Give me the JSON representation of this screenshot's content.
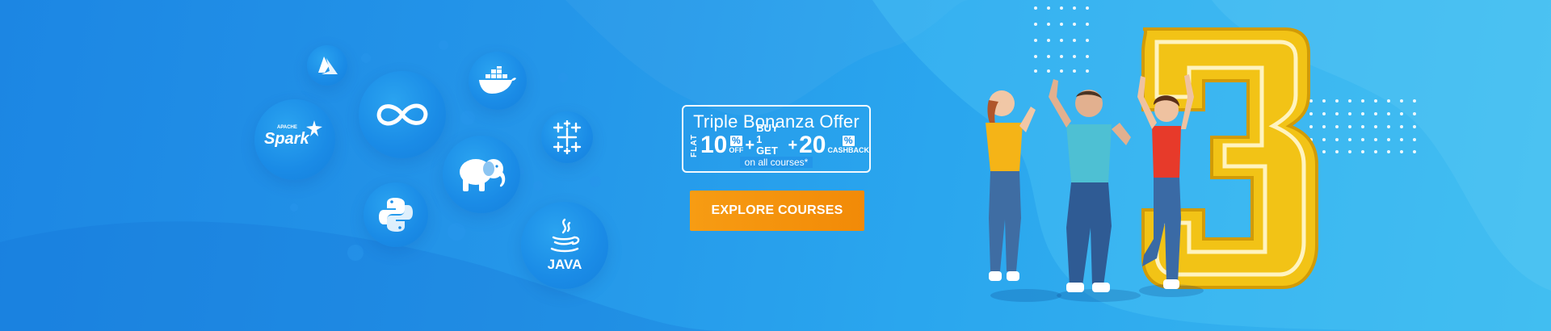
{
  "technologies": [
    {
      "name": "azure",
      "label": ""
    },
    {
      "name": "spark",
      "label_small": "APACHE",
      "label": "Spark"
    },
    {
      "name": "devops",
      "label": ""
    },
    {
      "name": "docker",
      "label": ""
    },
    {
      "name": "tableau",
      "label": ""
    },
    {
      "name": "hadoop",
      "label": ""
    },
    {
      "name": "python",
      "label": ""
    },
    {
      "name": "java",
      "label": "JAVA"
    }
  ],
  "offer": {
    "title": "Triple Bonanza Offer",
    "flat": "FLAT",
    "discount": "10",
    "percent": "%",
    "off": "OFF",
    "plus": "+",
    "buy_line1": "BUY 1",
    "buy_line2": "GET 1",
    "cashback": "20",
    "cashback_label": "CASHBACK",
    "note": "on all courses*"
  },
  "cta": {
    "label": "EXPLORE COURSES"
  },
  "colors": {
    "accent": "#f28a07",
    "background": "#2496e9",
    "gold": "#f2c316"
  }
}
